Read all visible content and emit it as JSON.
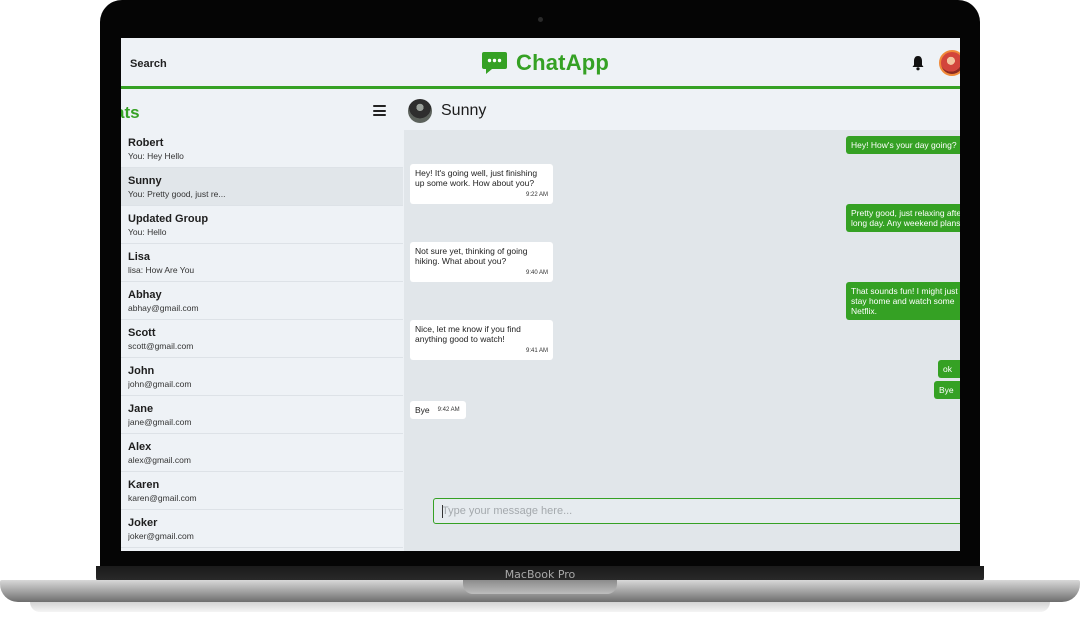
{
  "device_label": "MacBook Pro",
  "header": {
    "search_label": "Search",
    "brand": "ChatApp",
    "brand_color": "#35a124"
  },
  "sidebar": {
    "title": "ats",
    "chats": [
      {
        "name": "Robert",
        "subtitle": "You: Hey Hello"
      },
      {
        "name": "Sunny",
        "subtitle": "You: Pretty good, just re..."
      },
      {
        "name": "Updated Group",
        "subtitle": "You: Hello"
      },
      {
        "name": "Lisa",
        "subtitle": "lisa: How Are You"
      },
      {
        "name": "Abhay",
        "subtitle": "abhay@gmail.com"
      },
      {
        "name": "Scott",
        "subtitle": "scott@gmail.com"
      },
      {
        "name": "John",
        "subtitle": "john@gmail.com"
      },
      {
        "name": "Jane",
        "subtitle": "jane@gmail.com"
      },
      {
        "name": "Alex",
        "subtitle": "alex@gmail.com"
      },
      {
        "name": "Karen",
        "subtitle": "karen@gmail.com"
      },
      {
        "name": "Joker",
        "subtitle": "joker@gmail.com"
      }
    ]
  },
  "conversation": {
    "contact_name": "Sunny",
    "messages": [
      {
        "side": "out",
        "text": "Hey! How's your day going?"
      },
      {
        "side": "in",
        "text": "Hey! It's going well, just finishing up some work. How about you?",
        "time": "9:22 AM"
      },
      {
        "side": "out",
        "text": "Pretty good, just relaxing after a long day. Any weekend plans?"
      },
      {
        "side": "in",
        "text": "Not sure yet, thinking of going hiking. What about you?",
        "time": "9:40 AM"
      },
      {
        "side": "out",
        "text": "That sounds fun! I might just stay home and watch some Netflix."
      },
      {
        "side": "in",
        "text": "Nice, let me know if you find anything good to watch!",
        "time": "9:41 AM"
      },
      {
        "side": "out",
        "text": "ok"
      },
      {
        "side": "out",
        "text": "Bye"
      },
      {
        "side": "in",
        "text": "Bye",
        "time": "9:42 AM"
      }
    ],
    "composer_placeholder": "Type your message here..."
  }
}
